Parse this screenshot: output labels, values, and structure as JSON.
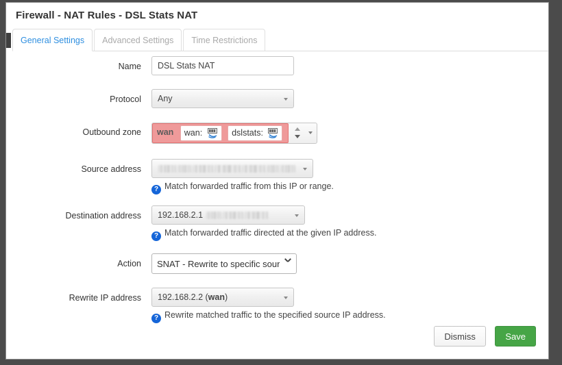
{
  "window": {
    "title": "Firewall - NAT Rules - DSL Stats NAT"
  },
  "tabs": [
    {
      "label": "General Settings",
      "active": true
    },
    {
      "label": "Advanced Settings",
      "active": false
    },
    {
      "label": "Time Restrictions",
      "active": false
    }
  ],
  "form": {
    "name": {
      "label": "Name",
      "value": "DSL Stats NAT",
      "placeholder": ""
    },
    "protocol": {
      "label": "Protocol",
      "value": "Any"
    },
    "outbound_zone": {
      "label": "Outbound zone",
      "zone": "wan",
      "chips": [
        {
          "label": "wan:",
          "icon": "network-interface-icon"
        },
        {
          "label": "dslstats:",
          "icon": "network-interface-icon"
        }
      ]
    },
    "source_address": {
      "label": "Source address",
      "value": "",
      "redacted": true,
      "hint": "Match forwarded traffic from this IP or range."
    },
    "destination_address": {
      "label": "Destination address",
      "value": "192.168.2.1",
      "value_suffix_redacted": true,
      "hint": "Match forwarded traffic directed at the given IP address."
    },
    "action": {
      "label": "Action",
      "value": "SNAT - Rewrite to specific source IP",
      "display": "SNAT - Rewrite to specific sourc"
    },
    "rewrite_ip": {
      "label": "Rewrite IP address",
      "value_prefix": "192.168.2.2 (",
      "value_bold": "wan",
      "value_suffix": ")",
      "hint": "Rewrite matched traffic to the specified source IP address."
    }
  },
  "footer": {
    "dismiss_label": "Dismiss",
    "save_label": "Save"
  },
  "colors": {
    "accent_link": "#2f8fe0",
    "zone_highlight": "#ef9a9a",
    "save_green": "#46a546",
    "help_blue": "#1565d8",
    "frame_border": "#8e8e8e"
  },
  "icons": {
    "help": "?",
    "spinner_up": "spinner-up-icon",
    "spinner_down": "spinner-down-icon",
    "caret": "chevron-down-icon"
  }
}
